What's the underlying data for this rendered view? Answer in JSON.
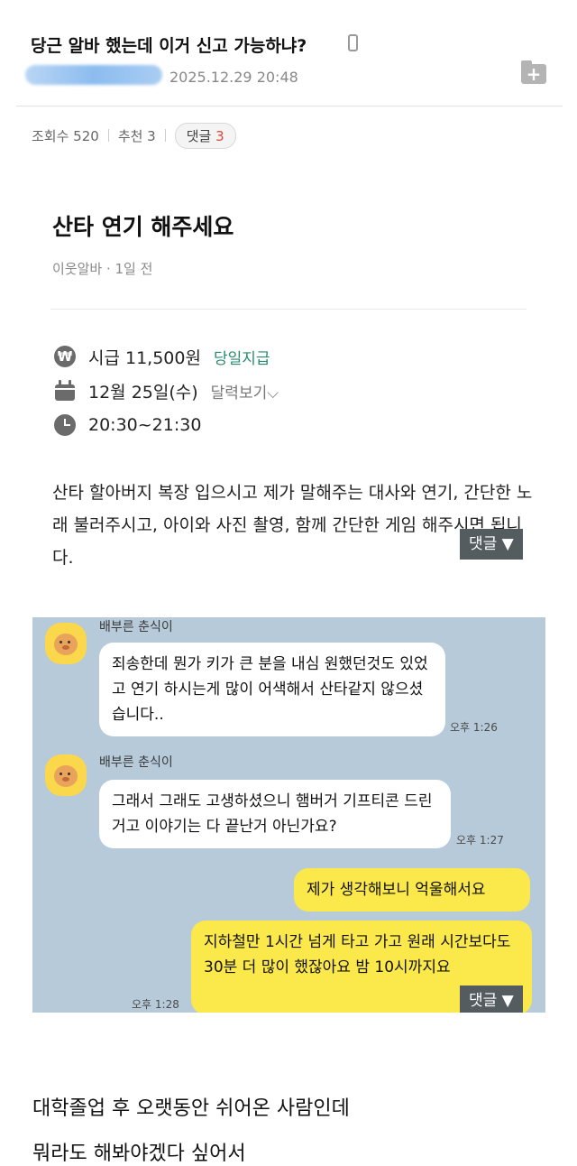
{
  "post": {
    "title": "당근 알바 했는데 이거 신고 가능하냐?",
    "date": "2025.12.29 20:48",
    "stats": {
      "views": "조회수 520",
      "recommend": "추천 3",
      "comments_label": "댓글",
      "comments_count": "3"
    }
  },
  "job": {
    "title": "산타 연기 해주세요",
    "meta": "이웃알바 · 1일 전",
    "pay": "시급 11,500원",
    "pay_tag": "당일지급",
    "date": "12월 25일(수)",
    "calendar_link": "달력보기",
    "time": "20:30~21:30",
    "description": "산타 할아버지 복장 입으시고 제가 말해주는 대사와 연기, 간단한 노래 불러주시고, 아이와 사진 촬영, 함께 간단한 게임 해주시면 됩니다."
  },
  "comment_tab_label": "댓글 ▼",
  "chat": {
    "sender_name": "배부른 춘식이",
    "messages": [
      {
        "text": "죄송한데 뭔가 키가 큰 분을 내심 원했던것도 있었고 연기 하시는게 많이 어색해서 산타같지 않으셨습니다..",
        "time": "오후 1:26"
      },
      {
        "text": "그래서 그래도 고생하셨으니 햄버거 기프티콘 드린거고 이야기는 다 끝난거 아닌가요?",
        "time": "오후 1:27"
      },
      {
        "text": "제가 생각해보니 억울해서요",
        "time": ""
      },
      {
        "text": "지하철만 1시간 넘게 타고 가고 원래 시간보다도 30분 더 많이 했잖아요 밤 10시까지요",
        "time": "오후 1:28"
      }
    ]
  },
  "body": {
    "line1": "대학졸업 후 오랫동안 쉬어온 사람인데",
    "line2": "뭐라도 해봐야겠다 싶어서"
  }
}
